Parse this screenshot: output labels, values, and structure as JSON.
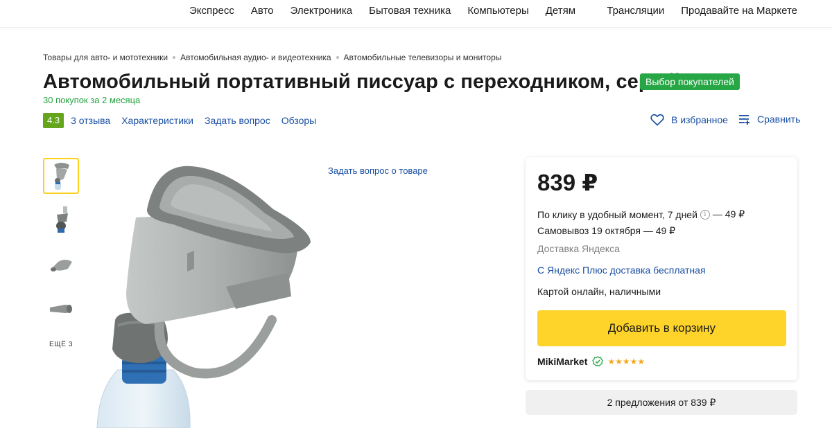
{
  "nav": {
    "categories": [
      "Экспресс",
      "Авто",
      "Электроника",
      "Бытовая техника",
      "Компьютеры",
      "Детям"
    ],
    "right": [
      "Трансляции",
      "Продавайте на Маркете"
    ]
  },
  "breadcrumbs": [
    "Товары для авто- и мототехники",
    "Автомобильная аудио- и видеотехника",
    "Автомобильные телевизоры и мониторы"
  ],
  "product": {
    "title": "Автомобильный портативный писсуар с переходником, серый",
    "badge": "Выбор покупателей",
    "purchases": "30 покупок за 2 месяца",
    "rating": "4.3",
    "links": {
      "reviews": "3 отзыва",
      "specs": "Характеристики",
      "question": "Задать вопрос",
      "overviews": "Обзоры"
    },
    "favorite_label": "В избранное",
    "compare_label": "Сравнить",
    "more_photos": "ЕЩЁ 3",
    "ask_question": "Задать вопрос о товаре"
  },
  "buybox": {
    "price": "839 ₽",
    "delivery_click_prefix": "По клику",
    "delivery_click_rest": " в удобный момент, 7 дней",
    "delivery_click_price": "— 49 ₽",
    "pickup": "Самовывоз 19 октября — 49 ₽",
    "provider": "Доставка Яндекса",
    "plus": "С Яндекс Плюс доставка бесплатная",
    "payment": "Картой онлайн, наличными",
    "cart_button": "Добавить в корзину",
    "seller": "MikiMarket",
    "seller_stars": 5
  },
  "offers": "2 предложения от 839 ₽",
  "colors": {
    "accent_yellow": "#fed42b",
    "badge_green": "#27a645",
    "rating_green": "#64a51b",
    "link_blue": "#1a4fa3"
  }
}
